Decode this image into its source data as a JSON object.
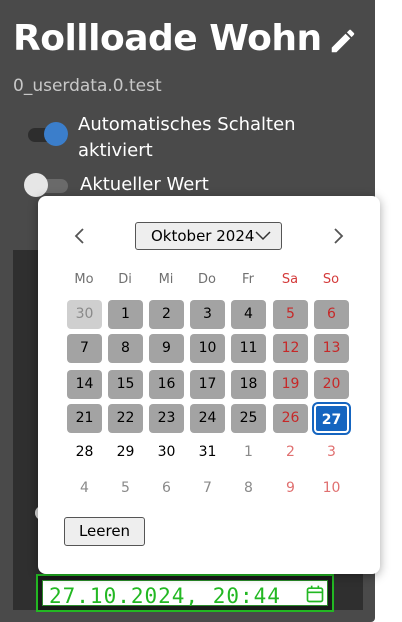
{
  "widget": {
    "title": "Rollloade Wohn",
    "subtitle": "0_userdata.0.test",
    "toggles": [
      {
        "label": "Automatisches Schalten aktiviert",
        "on": true
      },
      {
        "label": "Aktueller Wert",
        "on": false
      }
    ],
    "datetime_value": "27.10.2024, 20:44"
  },
  "datepicker": {
    "month_label": "Oktober 2024",
    "weekdays": [
      "Mo",
      "Di",
      "Mi",
      "Do",
      "Fr",
      "Sa",
      "So"
    ],
    "weeks": [
      [
        "30",
        "1",
        "2",
        "3",
        "4",
        "5",
        "6"
      ],
      [
        "7",
        "8",
        "9",
        "10",
        "11",
        "12",
        "13"
      ],
      [
        "14",
        "15",
        "16",
        "17",
        "18",
        "19",
        "20"
      ],
      [
        "21",
        "22",
        "23",
        "24",
        "25",
        "26",
        "27"
      ],
      [
        "28",
        "29",
        "30",
        "31",
        "1",
        "2",
        "3"
      ],
      [
        "4",
        "5",
        "6",
        "7",
        "8",
        "9",
        "10"
      ]
    ],
    "selected_day": "27",
    "clear_label": "Leeren"
  },
  "colors": {
    "selected": "#1565c0",
    "weekend": "#c62828",
    "input_text": "#23b823"
  }
}
